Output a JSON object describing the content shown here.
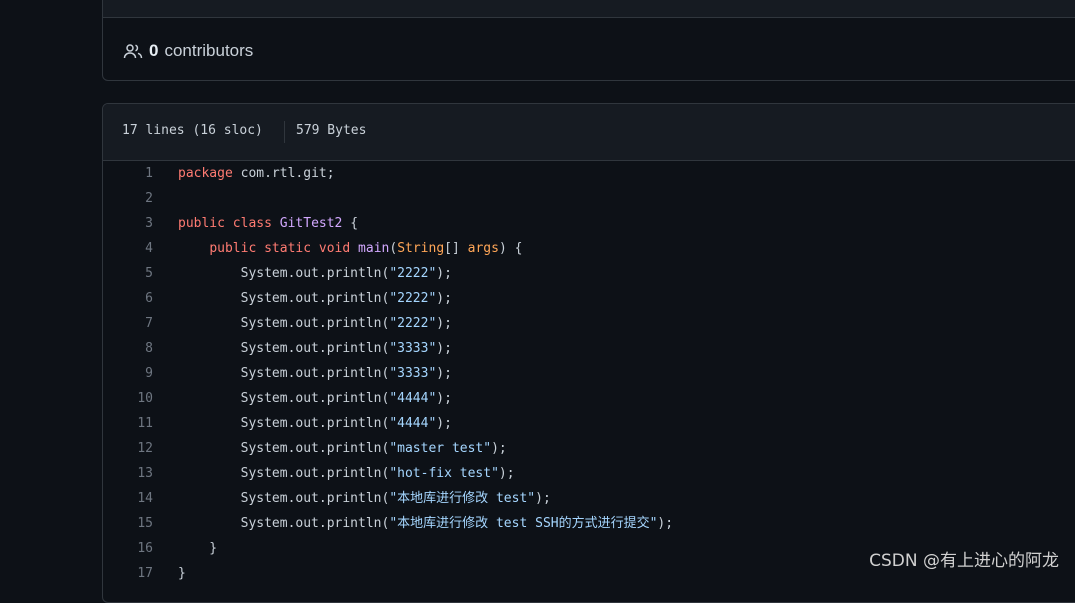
{
  "contributors": {
    "count": "0",
    "label": "contributors",
    "icon": "people-icon"
  },
  "file_info": {
    "lines": "17 lines (16 sloc)",
    "size": "579 Bytes"
  },
  "code_lines": [
    {
      "n": "1",
      "tokens": [
        {
          "t": "package",
          "c": "kw"
        },
        {
          "t": " com.rtl.git;",
          "c": ""
        }
      ]
    },
    {
      "n": "2",
      "tokens": []
    },
    {
      "n": "3",
      "tokens": [
        {
          "t": "public",
          "c": "kw"
        },
        {
          "t": " ",
          "c": ""
        },
        {
          "t": "class",
          "c": "kw"
        },
        {
          "t": " ",
          "c": ""
        },
        {
          "t": "GitTest2",
          "c": "ent"
        },
        {
          "t": " {",
          "c": ""
        }
      ]
    },
    {
      "n": "4",
      "tokens": [
        {
          "t": "    ",
          "c": ""
        },
        {
          "t": "public",
          "c": "kw"
        },
        {
          "t": " ",
          "c": ""
        },
        {
          "t": "static",
          "c": "kw"
        },
        {
          "t": " ",
          "c": ""
        },
        {
          "t": "void",
          "c": "kw"
        },
        {
          "t": " ",
          "c": ""
        },
        {
          "t": "main",
          "c": "ent"
        },
        {
          "t": "(",
          "c": ""
        },
        {
          "t": "String",
          "c": "var"
        },
        {
          "t": "[] ",
          "c": ""
        },
        {
          "t": "args",
          "c": "var"
        },
        {
          "t": ") {",
          "c": ""
        }
      ]
    },
    {
      "n": "5",
      "tokens": [
        {
          "t": "        System.out.println(",
          "c": ""
        },
        {
          "t": "\"2222\"",
          "c": "str"
        },
        {
          "t": ");",
          "c": ""
        }
      ]
    },
    {
      "n": "6",
      "tokens": [
        {
          "t": "        System.out.println(",
          "c": ""
        },
        {
          "t": "\"2222\"",
          "c": "str"
        },
        {
          "t": ");",
          "c": ""
        }
      ]
    },
    {
      "n": "7",
      "tokens": [
        {
          "t": "        System.out.println(",
          "c": ""
        },
        {
          "t": "\"2222\"",
          "c": "str"
        },
        {
          "t": ");",
          "c": ""
        }
      ]
    },
    {
      "n": "8",
      "tokens": [
        {
          "t": "        System.out.println(",
          "c": ""
        },
        {
          "t": "\"3333\"",
          "c": "str"
        },
        {
          "t": ");",
          "c": ""
        }
      ]
    },
    {
      "n": "9",
      "tokens": [
        {
          "t": "        System.out.println(",
          "c": ""
        },
        {
          "t": "\"3333\"",
          "c": "str"
        },
        {
          "t": ");",
          "c": ""
        }
      ]
    },
    {
      "n": "10",
      "tokens": [
        {
          "t": "        System.out.println(",
          "c": ""
        },
        {
          "t": "\"4444\"",
          "c": "str"
        },
        {
          "t": ");",
          "c": ""
        }
      ]
    },
    {
      "n": "11",
      "tokens": [
        {
          "t": "        System.out.println(",
          "c": ""
        },
        {
          "t": "\"4444\"",
          "c": "str"
        },
        {
          "t": ");",
          "c": ""
        }
      ]
    },
    {
      "n": "12",
      "tokens": [
        {
          "t": "        System.out.println(",
          "c": ""
        },
        {
          "t": "\"master test\"",
          "c": "str"
        },
        {
          "t": ");",
          "c": ""
        }
      ]
    },
    {
      "n": "13",
      "tokens": [
        {
          "t": "        System.out.println(",
          "c": ""
        },
        {
          "t": "\"hot-fix test\"",
          "c": "str"
        },
        {
          "t": ");",
          "c": ""
        }
      ]
    },
    {
      "n": "14",
      "tokens": [
        {
          "t": "        System.out.println(",
          "c": ""
        },
        {
          "t": "\"本地库进行修改 test\"",
          "c": "str"
        },
        {
          "t": ");",
          "c": ""
        }
      ]
    },
    {
      "n": "15",
      "tokens": [
        {
          "t": "        System.out.println(",
          "c": ""
        },
        {
          "t": "\"本地库进行修改 test SSH的方式进行提交\"",
          "c": "str"
        },
        {
          "t": ");",
          "c": ""
        }
      ]
    },
    {
      "n": "16",
      "tokens": [
        {
          "t": "    }",
          "c": ""
        }
      ]
    },
    {
      "n": "17",
      "tokens": [
        {
          "t": "}",
          "c": ""
        }
      ]
    }
  ],
  "watermark": "CSDN @有上进心的阿龙",
  "colors": {
    "background": "#0d1117",
    "header": "#161b22",
    "border": "#30363d",
    "keyword": "#ff7b72",
    "entity": "#d2a8ff",
    "string": "#a5d6ff",
    "variable": "#ffa657",
    "line_number": "#6e7681"
  }
}
